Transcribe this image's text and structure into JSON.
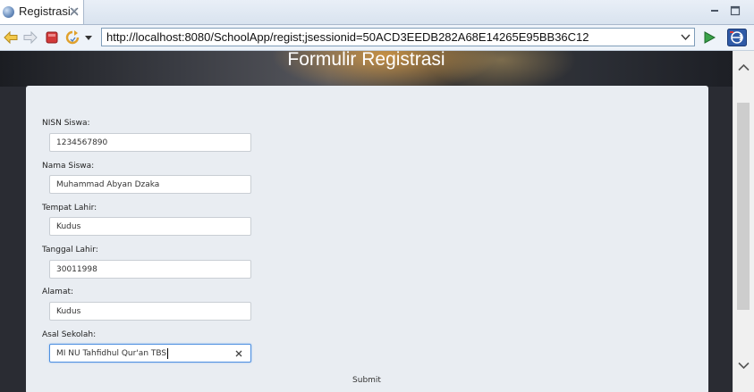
{
  "tab": {
    "title": "Registrasi"
  },
  "toolbar": {
    "url": "http://localhost:8080/SchoolApp/regist;jsessionid=50ACD3EEDB282A68E14265E95BB36C12"
  },
  "page": {
    "title": "Formulir Registrasi",
    "fields": [
      {
        "label": "NISN Siswa:",
        "value": "1234567890"
      },
      {
        "label": "Nama Siswa:",
        "value": "Muhammad Abyan Dzaka"
      },
      {
        "label": "Tempat Lahir:",
        "value": "Kudus"
      },
      {
        "label": "Tanggal Lahir:",
        "value": "30011998"
      },
      {
        "label": "Alamat:",
        "value": "Kudus"
      },
      {
        "label": "Asal Sekolah:",
        "value": "MI NU Tahfidhul Qur'an TBS"
      }
    ],
    "submit_label": "Submit"
  },
  "icons": {
    "tab": [
      "globe-icon",
      "close-tab-icon"
    ],
    "window": [
      "minimize-icon",
      "maximize-icon"
    ],
    "toolbar": [
      "back-arrow-icon",
      "forward-arrow-icon",
      "stop-icon",
      "refresh-icon",
      "refresh-dropdown-icon",
      "url-dropdown-icon",
      "go-icon",
      "external-browser-icon"
    ]
  },
  "colors": {
    "accent_focus": "#4d8fe0",
    "stop_red": "#d23a3a",
    "go_green": "#3aa24a",
    "nav_yellow": "#f2c84b"
  }
}
